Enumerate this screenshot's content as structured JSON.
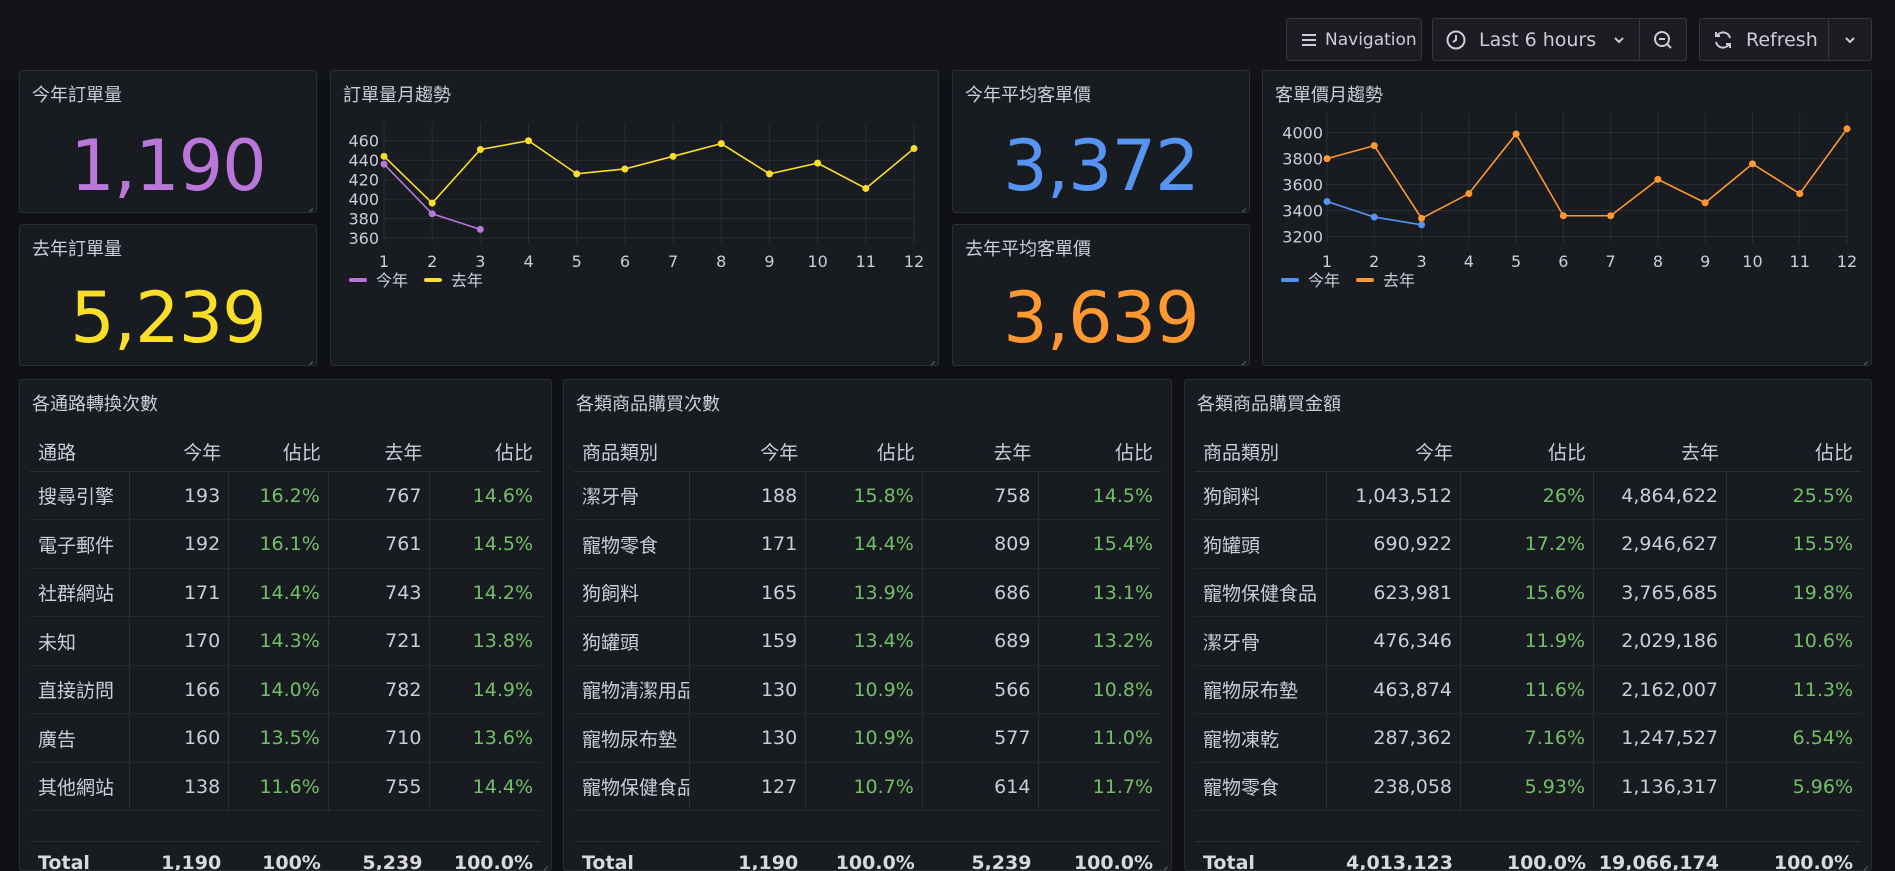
{
  "toolbar": {
    "navigation_label": "Navigation",
    "time_range_label": "Last 6 hours",
    "refresh_label": "Refresh"
  },
  "stats": {
    "this_year_orders": {
      "title": "今年訂單量",
      "value": "1,190",
      "color": "#b877d9"
    },
    "last_year_orders": {
      "title": "去年訂單量",
      "value": "5,239",
      "color": "#fade2a"
    },
    "this_year_avg": {
      "title": "今年平均客單價",
      "value": "3,372",
      "color": "#5794f2"
    },
    "last_year_avg": {
      "title": "去年平均客單價",
      "value": "3,639",
      "color": "#ff9830"
    }
  },
  "charts": {
    "orders_trend": {
      "title": "訂單量月趨勢"
    },
    "avg_trend": {
      "title": "客單價月趨勢"
    }
  },
  "chart_data": [
    {
      "type": "line",
      "title": "訂單量月趨勢",
      "x": [
        1,
        2,
        3,
        4,
        5,
        6,
        7,
        8,
        9,
        10,
        11,
        12
      ],
      "ylim": [
        355,
        470
      ],
      "yticks": [
        360,
        380,
        400,
        420,
        440,
        460
      ],
      "grid": true,
      "legend": "bottom-left",
      "series": [
        {
          "name": "今年",
          "color": "#b877d9",
          "values": [
            436,
            385,
            369
          ]
        },
        {
          "name": "去年",
          "color": "#fade2a",
          "values": [
            444,
            396,
            451,
            460,
            426,
            431,
            444,
            457,
            426,
            437,
            411,
            452
          ]
        }
      ]
    },
    {
      "type": "line",
      "title": "客單價月趨勢",
      "x": [
        1,
        2,
        3,
        4,
        5,
        6,
        7,
        8,
        9,
        10,
        11,
        12
      ],
      "ylim": [
        3150,
        4090
      ],
      "yticks": [
        3200,
        3400,
        3600,
        3800,
        4000
      ],
      "grid": true,
      "legend": "bottom-left",
      "series": [
        {
          "name": "今年",
          "color": "#5794f2",
          "values": [
            3470,
            3350,
            3290
          ]
        },
        {
          "name": "去年",
          "color": "#ff9830",
          "values": [
            3800,
            3900,
            3340,
            3530,
            3990,
            3360,
            3360,
            3640,
            3460,
            3760,
            3530,
            4030
          ]
        }
      ]
    }
  ],
  "tables": {
    "channels": {
      "title": "各通路轉換次數",
      "headers": [
        "通路",
        "今年",
        "佔比",
        "去年",
        "佔比"
      ],
      "rows": [
        [
          "搜尋引擎",
          "193",
          "16.2%",
          "767",
          "14.6%"
        ],
        [
          "電子郵件",
          "192",
          "16.1%",
          "761",
          "14.5%"
        ],
        [
          "社群網站",
          "171",
          "14.4%",
          "743",
          "14.2%"
        ],
        [
          "未知",
          "170",
          "14.3%",
          "721",
          "13.8%"
        ],
        [
          "直接訪問",
          "166",
          "14.0%",
          "782",
          "14.9%"
        ],
        [
          "廣告",
          "160",
          "13.5%",
          "710",
          "13.6%"
        ],
        [
          "其他網站",
          "138",
          "11.6%",
          "755",
          "14.4%"
        ]
      ],
      "total": [
        "Total",
        "1,190",
        "100%",
        "5,239",
        "100.0%"
      ]
    },
    "category_counts": {
      "title": "各類商品購買次數",
      "headers": [
        "商品類別",
        "今年",
        "佔比",
        "去年",
        "佔比"
      ],
      "rows": [
        [
          "潔牙骨",
          "188",
          "15.8%",
          "758",
          "14.5%"
        ],
        [
          "寵物零食",
          "171",
          "14.4%",
          "809",
          "15.4%"
        ],
        [
          "狗飼料",
          "165",
          "13.9%",
          "686",
          "13.1%"
        ],
        [
          "狗罐頭",
          "159",
          "13.4%",
          "689",
          "13.2%"
        ],
        [
          "寵物清潔用品",
          "130",
          "10.9%",
          "566",
          "10.8%"
        ],
        [
          "寵物尿布墊",
          "130",
          "10.9%",
          "577",
          "11.0%"
        ],
        [
          "寵物保健食品",
          "127",
          "10.7%",
          "614",
          "11.7%"
        ]
      ],
      "total": [
        "Total",
        "1,190",
        "100.0%",
        "5,239",
        "100.0%"
      ]
    },
    "category_amounts": {
      "title": "各類商品購買金額",
      "headers": [
        "商品類別",
        "今年",
        "佔比",
        "去年",
        "佔比"
      ],
      "rows": [
        [
          "狗飼料",
          "1,043,512",
          "26%",
          "4,864,622",
          "25.5%"
        ],
        [
          "狗罐頭",
          "690,922",
          "17.2%",
          "2,946,627",
          "15.5%"
        ],
        [
          "寵物保健食品",
          "623,981",
          "15.6%",
          "3,765,685",
          "19.8%"
        ],
        [
          "潔牙骨",
          "476,346",
          "11.9%",
          "2,029,186",
          "10.6%"
        ],
        [
          "寵物尿布墊",
          "463,874",
          "11.6%",
          "2,162,007",
          "11.3%"
        ],
        [
          "寵物凍乾",
          "287,362",
          "7.16%",
          "1,247,527",
          "6.54%"
        ],
        [
          "寵物零食",
          "238,058",
          "5.93%",
          "1,136,317",
          "5.96%"
        ]
      ],
      "total": [
        "Total",
        "4,013,123",
        "100.0%",
        "19,066,174",
        "100.0%"
      ]
    }
  }
}
